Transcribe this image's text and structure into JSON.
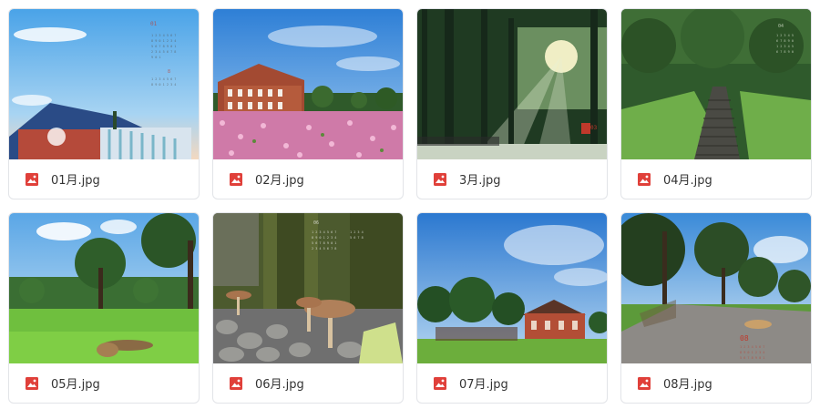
{
  "files": [
    {
      "name": "01月.jpg",
      "thumb_icon": "image-file-icon",
      "calendar_month": "01",
      "scene": "sky-building"
    },
    {
      "name": "02月.jpg",
      "thumb_icon": "image-file-icon",
      "calendar_month": "02",
      "scene": "flower-field"
    },
    {
      "name": "3月.jpg",
      "thumb_icon": "image-file-icon",
      "calendar_month": "03",
      "scene": "forest-light"
    },
    {
      "name": "04月.jpg",
      "thumb_icon": "image-file-icon",
      "calendar_month": "04",
      "scene": "green-stairs"
    },
    {
      "name": "05月.jpg",
      "thumb_icon": "image-file-icon",
      "calendar_month": "05",
      "scene": "lawn-dog"
    },
    {
      "name": "06月.jpg",
      "thumb_icon": "image-file-icon",
      "calendar_month": "06",
      "scene": "mushrooms"
    },
    {
      "name": "07月.jpg",
      "thumb_icon": "image-file-icon",
      "calendar_month": "07",
      "scene": "brick-hall"
    },
    {
      "name": "08月.jpg",
      "thumb_icon": "image-file-icon",
      "calendar_month": "08",
      "scene": "park-road"
    }
  ],
  "colors": {
    "file_icon": "#e0403a",
    "card_border": "#e2e4e8",
    "label_text": "#333333"
  }
}
